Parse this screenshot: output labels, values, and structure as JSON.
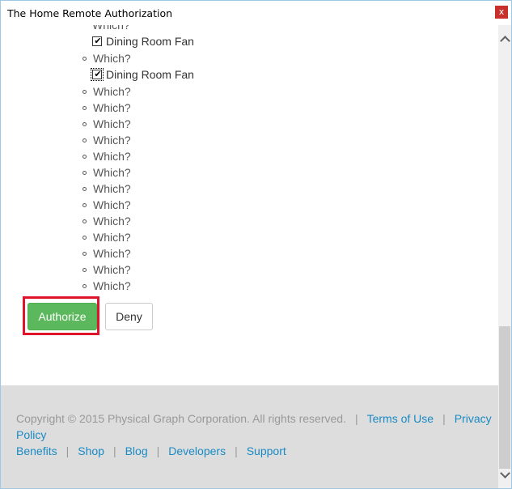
{
  "window": {
    "title": "The Home Remote Authorization",
    "close_label": "x"
  },
  "devices": {
    "partial_top": "Which?",
    "items": [
      {
        "type": "check",
        "label": "Dining Room Fan",
        "checked": true,
        "focused": false
      },
      {
        "type": "bullet",
        "label": "Which?"
      },
      {
        "type": "check",
        "label": "Dining Room Fan",
        "checked": true,
        "focused": true
      },
      {
        "type": "bullet",
        "label": "Which?"
      },
      {
        "type": "bullet",
        "label": "Which?"
      },
      {
        "type": "bullet",
        "label": "Which?"
      },
      {
        "type": "bullet",
        "label": "Which?"
      },
      {
        "type": "bullet",
        "label": "Which?"
      },
      {
        "type": "bullet",
        "label": "Which?"
      },
      {
        "type": "bullet",
        "label": "Which?"
      },
      {
        "type": "bullet",
        "label": "Which?"
      },
      {
        "type": "bullet",
        "label": "Which?"
      },
      {
        "type": "bullet",
        "label": "Which?"
      },
      {
        "type": "bullet",
        "label": "Which?"
      },
      {
        "type": "bullet",
        "label": "Which?"
      },
      {
        "type": "bullet",
        "label": "Which?"
      }
    ]
  },
  "actions": {
    "authorize_label": "Authorize",
    "deny_label": "Deny"
  },
  "footer": {
    "copyright": "Copyright © 2015 Physical Graph Corporation. All rights reserved.",
    "separator": "|",
    "terms_label": "Terms of Use",
    "privacy_label_1": "Privacy",
    "privacy_label_2": "Policy",
    "links": [
      "Benefits",
      "Shop",
      "Blog",
      "Developers",
      "Support"
    ]
  },
  "colors": {
    "authorize_green": "#5cb85c",
    "highlight_red": "#e0142a",
    "link_blue": "#1a8ac4",
    "footer_bg": "#dddddd"
  }
}
